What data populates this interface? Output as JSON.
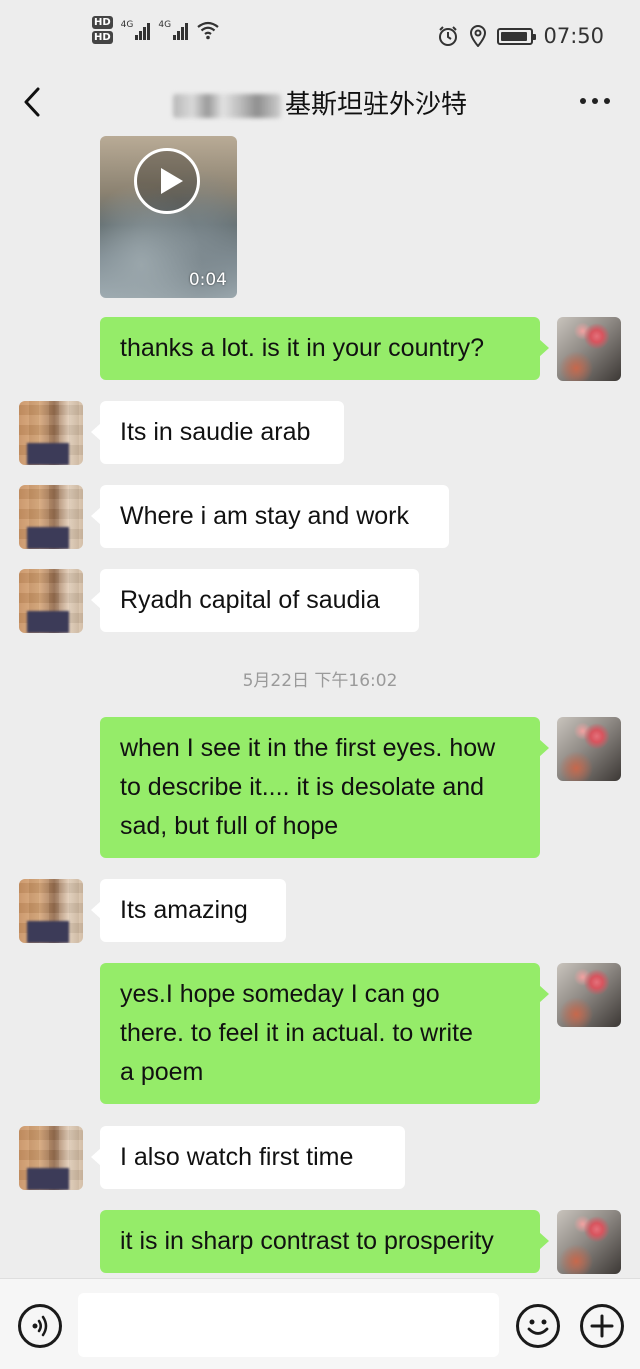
{
  "status_bar": {
    "hd1": "HD",
    "hd2": "HD",
    "net1": "4G",
    "net2": "4G",
    "time": "07:50"
  },
  "nav": {
    "title": "基斯坦驻外沙特"
  },
  "video": {
    "duration": "0:04"
  },
  "messages": [
    {
      "from": "me",
      "text": "thanks a lot.  is it in your country?"
    },
    {
      "from": "them",
      "text": "Its in saudie arab"
    },
    {
      "from": "them",
      "text": "Where i am stay and work"
    },
    {
      "from": "them",
      "text": "Ryadh capital of saudia"
    },
    {
      "from": "me",
      "lines": [
        "when I see it in the first eyes. how",
        "to describe it.... it is desolate and",
        "sad, but full of hope"
      ]
    },
    {
      "from": "them",
      "text": "Its amazing"
    },
    {
      "from": "me",
      "lines": [
        "yes.I hope someday I can go",
        "there.  to feel it in actual. to write",
        "a poem"
      ]
    },
    {
      "from": "them",
      "text": "I also watch first time"
    },
    {
      "from": "me",
      "text": "it is in sharp contrast to prosperity"
    }
  ],
  "timestamp": "5月22日 下午16:02",
  "input": {
    "value": ""
  }
}
